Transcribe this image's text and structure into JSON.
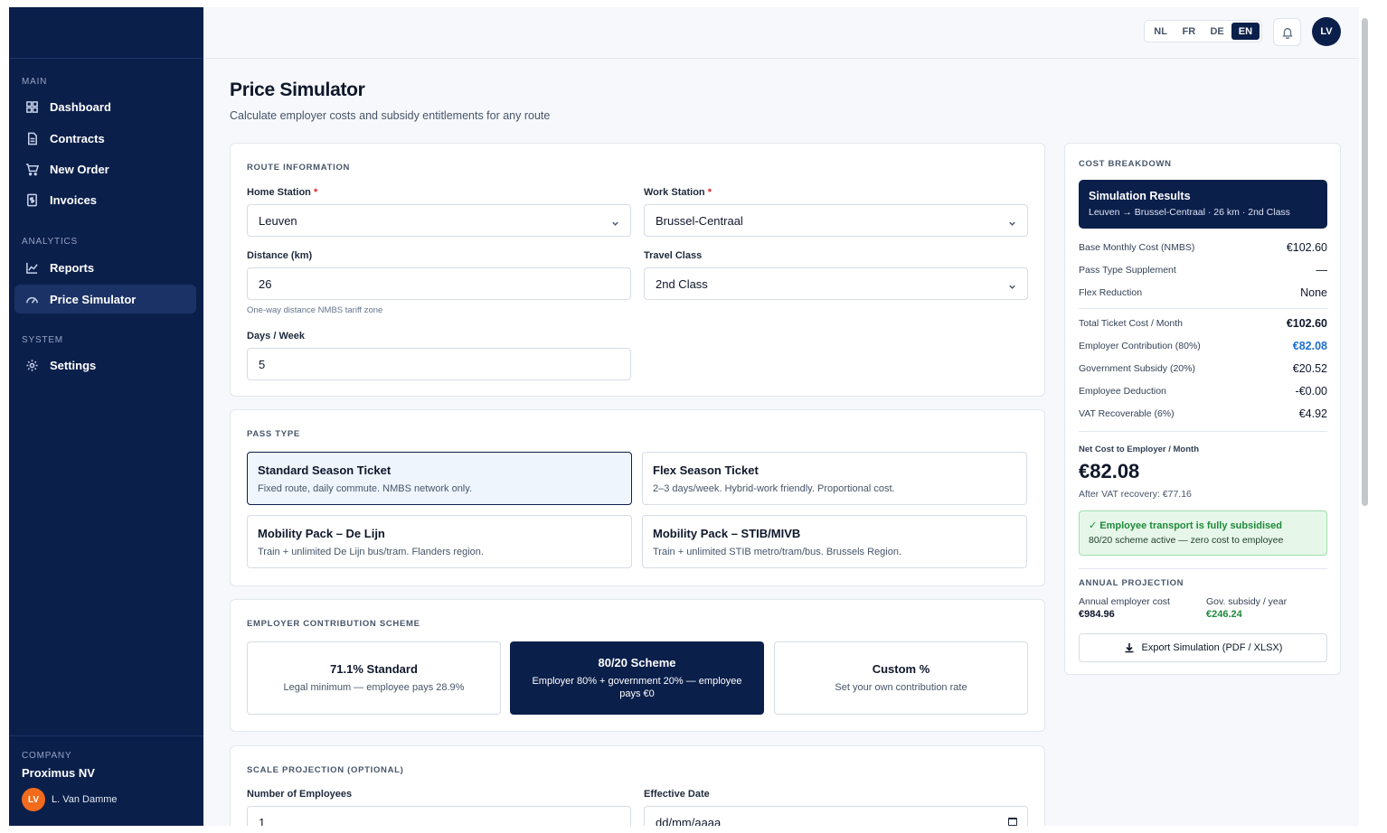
{
  "sidebar": {
    "sections": {
      "main": "MAIN",
      "analytics": "ANALYTICS",
      "system": "SYSTEM"
    },
    "items": {
      "dashboard": "Dashboard",
      "contracts": "Contracts",
      "new_order": "New Order",
      "invoices": "Invoices",
      "reports": "Reports",
      "price_simulator": "Price Simulator",
      "settings": "Settings"
    },
    "company_label": "COMPANY",
    "company_name": "Proximus NV",
    "user_initials": "LV",
    "user_name": "L. Van Damme"
  },
  "topbar": {
    "languages": [
      "NL",
      "FR",
      "DE",
      "EN"
    ],
    "active_language": "EN",
    "avatar_initials": "LV"
  },
  "page": {
    "title": "Price Simulator",
    "subtitle": "Calculate employer costs and subsidy entitlements for any route"
  },
  "route": {
    "title": "ROUTE INFORMATION",
    "home_label": "Home Station",
    "home_value": "Leuven",
    "work_label": "Work Station",
    "work_value": "Brussel-Centraal",
    "required_mark": "*",
    "distance_label": "Distance (km)",
    "distance_value": "26",
    "distance_hint": "One-way distance NMBS tariff zone",
    "class_label": "Travel Class",
    "class_value": "2nd Class",
    "days_label": "Days / Week",
    "days_value": "5"
  },
  "pass_type": {
    "title": "PASS TYPE",
    "options": [
      {
        "title": "Standard Season Ticket",
        "desc": "Fixed route, daily commute. NMBS network only."
      },
      {
        "title": "Flex Season Ticket",
        "desc": "2–3 days/week. Hybrid-work friendly. Proportional cost."
      },
      {
        "title": "Mobility Pack – De Lijn",
        "desc": "Train + unlimited De Lijn bus/tram. Flanders region."
      },
      {
        "title": "Mobility Pack – STIB/MIVB",
        "desc": "Train + unlimited STIB metro/tram/bus. Brussels Region."
      }
    ]
  },
  "scheme": {
    "title": "EMPLOYER CONTRIBUTION SCHEME",
    "options": [
      {
        "title": "71.1% Standard",
        "desc": "Legal minimum — employee pays 28.9%"
      },
      {
        "title": "80/20 Scheme",
        "desc": "Employer 80% + government 20% — employee pays €0"
      },
      {
        "title": "Custom %",
        "desc": "Set your own contribution rate"
      }
    ]
  },
  "scale": {
    "title": "SCALE PROJECTION (OPTIONAL)",
    "employees_label": "Number of Employees",
    "employees_value": "1",
    "date_label": "Effective Date",
    "date_placeholder": "dd/mm/aaaa"
  },
  "cost": {
    "title": "COST BREAKDOWN",
    "banner_title": "Simulation Results",
    "banner_desc": "Leuven → Brussel-Centraal · 26 km · 2nd Class",
    "rows": [
      {
        "label": "Base Monthly Cost (NMBS)",
        "value": "€102.60"
      },
      {
        "label": "Pass Type Supplement",
        "value": "—"
      },
      {
        "label": "Flex Reduction",
        "value": "None"
      },
      {
        "label": "Total Ticket Cost / Month",
        "value": "€102.60"
      },
      {
        "label": "Employer Contribution (80%)",
        "value": "€82.08"
      },
      {
        "label": "Government Subsidy (20%)",
        "value": "€20.52"
      },
      {
        "label": "Employee Deduction",
        "value": "-€0.00"
      },
      {
        "label": "VAT Recoverable (6%)",
        "value": "€4.92"
      }
    ],
    "net_label": "Net Cost to Employer / Month",
    "net_value": "€82.08",
    "net_after_vat": "After VAT recovery: €77.16",
    "success_title": "✓ Employee transport is fully subsidised",
    "success_desc": "80/20 scheme active — zero cost to employee",
    "annual_title": "ANNUAL PROJECTION",
    "annual_employer_label": "Annual employer cost",
    "annual_employer_value": "€984.96",
    "annual_gov_label": "Gov. subsidy / year",
    "annual_gov_value": "€246.24",
    "export_label": "Export Simulation (PDF / XLSX)"
  },
  "colors": {
    "navy": "#0b1f4b",
    "accent_blue": "#1d6fd1",
    "success_green": "#1f8a3a",
    "required_red": "#dc2626",
    "avatar_orange": "#f26b1d"
  }
}
